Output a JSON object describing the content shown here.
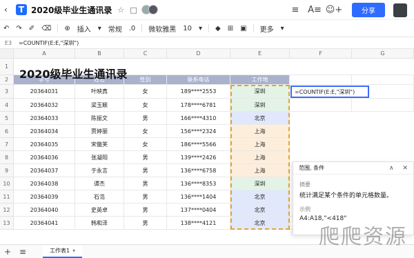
{
  "titlebar": {
    "title": "2020级毕业生通讯录",
    "share_label": "分享"
  },
  "toolbar": {
    "insert_label": "插入",
    "format_label": "常规",
    "decimal_label": ".0",
    "font_label": "微软雅黑",
    "font_size": "10",
    "more_label": "更多"
  },
  "formula_bar": {
    "cell_ref": "E3",
    "formula": "=COUNTIF(E:E,\"深圳\")"
  },
  "grid": {
    "columns": [
      "A",
      "B",
      "C",
      "D",
      "E",
      "F",
      "G"
    ],
    "rows": [
      "1",
      "2",
      "3",
      "4",
      "5",
      "6",
      "7",
      "8",
      "9",
      "10",
      "11",
      "12",
      "13"
    ],
    "title": "2020级毕业生通讯录",
    "headers": [
      "学号",
      "姓名",
      "性别",
      "联系电话",
      "工作地"
    ],
    "data": [
      [
        "20364031",
        "叶映真",
        "女",
        "189****2553",
        "深圳"
      ],
      [
        "20364032",
        "梁玉颖",
        "女",
        "178****6781",
        "深圳"
      ],
      [
        "20364033",
        "陈振文",
        "男",
        "166****4310",
        "北京"
      ],
      [
        "20364034",
        "贾婷丽",
        "女",
        "156****2324",
        "上海"
      ],
      [
        "20364035",
        "宋傲芙",
        "女",
        "186****5566",
        "上海"
      ],
      [
        "20364036",
        "张凝阳",
        "男",
        "139****2426",
        "上海"
      ],
      [
        "20364037",
        "于永言",
        "男",
        "136****6758",
        "上海"
      ],
      [
        "20364038",
        "谭杰",
        "男",
        "136****8353",
        "深圳"
      ],
      [
        "20364039",
        "石浩",
        "男",
        "136****1404",
        "北京"
      ],
      [
        "20364040",
        "史英卓",
        "男",
        "137****0404",
        "北京"
      ],
      [
        "20364041",
        "韩和泽",
        "男",
        "138****4121",
        "北京"
      ]
    ],
    "edit_cell_text": "=COUNTIF(E:E,\"深圳\")"
  },
  "popup": {
    "header": "范围, 条件",
    "summary_label": "摘要",
    "summary_text": "统计满足某个条件的单元格数量。",
    "example_label": "示例",
    "example_text": "A4:A18,\"<418\""
  },
  "tabs": {
    "sheet_name": "工作表1"
  },
  "watermark": "爬爬资源",
  "colors": {
    "accent": "#2e6bff",
    "header_fill": "#a9b2cc",
    "shenzhen": "#e3f3e6",
    "beijing": "#e1e8fb",
    "shanghai": "#fdeedc",
    "selection_dash": "#e3a62a"
  }
}
